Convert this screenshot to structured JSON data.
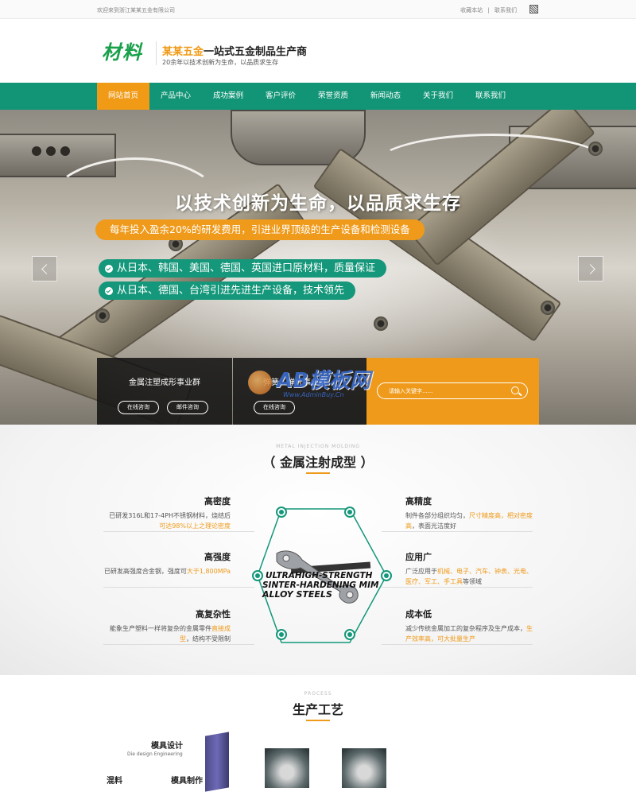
{
  "topbar": {
    "welcome": "欢迎来到浙江某某五金有限公司",
    "links": [
      "收藏本站",
      "|",
      "联系我们"
    ]
  },
  "header": {
    "logo": "材料",
    "title_accent": "某某五金",
    "title_rest": "一站式五金制品生产商",
    "subtitle": "20余年以技术创新为生命，以品质求生存"
  },
  "nav": {
    "items": [
      "网站首页",
      "产品中心",
      "成功案例",
      "客户评价",
      "荣誉资质",
      "新闻动态",
      "关于我们",
      "联系我们"
    ],
    "active_index": 0
  },
  "banner": {
    "headline": "以技术创新为生命，以品质求生存",
    "orange_pill": "每年投入盈余20%的研发费用，引进业界顶级的生产设备和检测设备",
    "green_pills": [
      "从日本、韩国、美国、德国、英国进口原材料，质量保证",
      "从日本、德国、台湾引进先进生产设备，技术领先"
    ]
  },
  "boxes": {
    "box1": {
      "title": "金属注塑成形事业群",
      "btn1": "在线咨询",
      "btn2": "邮件咨询"
    },
    "box2": {
      "title": "弹簧、弹片事业群",
      "btn1": "在线咨询"
    },
    "search": {
      "placeholder": "请输入关键字......"
    }
  },
  "watermark": {
    "main": "AB模板网",
    "url": "Www.AdminBuy.Cn"
  },
  "section_mim": {
    "eng": "METAL INJECTION MOLDING",
    "title": "（ 金属注射成型 ）",
    "left": [
      {
        "h": "高密度",
        "d_pre": "已研发316L和17-4PH不锈钢材料，烧结后",
        "d_hl": "可达98%以上之理论密度",
        "d_post": ""
      },
      {
        "h": "高强度",
        "d_pre": "已研发高强度合金钢，强度可",
        "d_hl": "大于1,800MPa",
        "d_post": ""
      },
      {
        "h": "高复杂性",
        "d_pre": "能象生产塑料一样将复杂的金属零件",
        "d_hl": "直接成型",
        "d_post": "，结构不受限制"
      }
    ],
    "right": [
      {
        "h": "高精度",
        "d_pre": "制件各部分组织均匀，",
        "d_hl": "尺寸精度高，相对密度高",
        "d_post": "，表面光洁度好"
      },
      {
        "h": "应用广",
        "d_pre": "广泛应用于",
        "d_hl": "机械、电子、汽车、钟表、光电、医疗、军工、手工具",
        "d_post": "等领域"
      },
      {
        "h": "成本低",
        "d_pre": "减少传统金属加工的复杂程序及生产成本，",
        "d_hl": "生产效率高，可大批量生产",
        "d_post": ""
      }
    ],
    "center_text": [
      "ULTRAHIGH-STRENGTH",
      "SINTER-HARDENING MIM",
      "ALLOY STEELS"
    ]
  },
  "section_process": {
    "eng": "PROCESS",
    "title": "生产工艺",
    "steps": [
      {
        "name": "模具设计",
        "en": "Die design Engineering"
      },
      {
        "name": "混料",
        "en": ""
      },
      {
        "name": "模具制作",
        "en": ""
      }
    ]
  }
}
